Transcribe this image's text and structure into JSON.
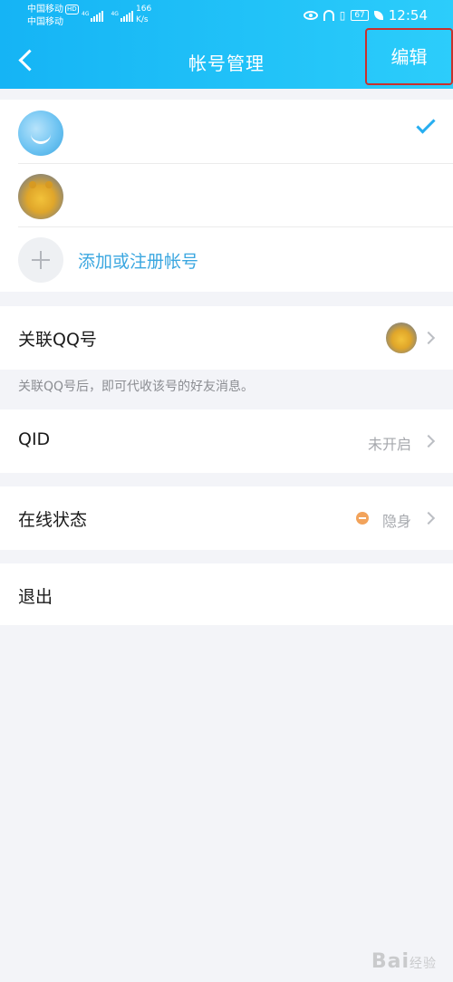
{
  "status_bar": {
    "carrier1": "中国移动",
    "hd": "HD",
    "carrier2": "中国移动",
    "net1": "4G",
    "net2": "4G",
    "speed": "166",
    "speed_unit": "K/s",
    "battery": "67",
    "time": "12:54"
  },
  "nav": {
    "title": "帐号管理",
    "edit_label": "编辑"
  },
  "accounts": {
    "items": [
      {
        "avatar": "avatar-blue-smile",
        "selected": true
      },
      {
        "avatar": "avatar-yellow-bear",
        "selected": false
      }
    ],
    "add_label": "添加或注册帐号"
  },
  "linked_qq": {
    "label": "关联QQ号",
    "hint": "关联QQ号后，即可代收该号的好友消息。"
  },
  "qid": {
    "label": "QID",
    "value": "未开启"
  },
  "online_status": {
    "label": "在线状态",
    "value": "隐身",
    "dot_color": "#f2a35b"
  },
  "logout": {
    "label": "退出"
  },
  "watermark": {
    "text": "Bai",
    "text2": "经验"
  },
  "colors": {
    "header": "#1fbcf7",
    "accent": "#27aef0",
    "highlight_box": "#c9302c"
  }
}
